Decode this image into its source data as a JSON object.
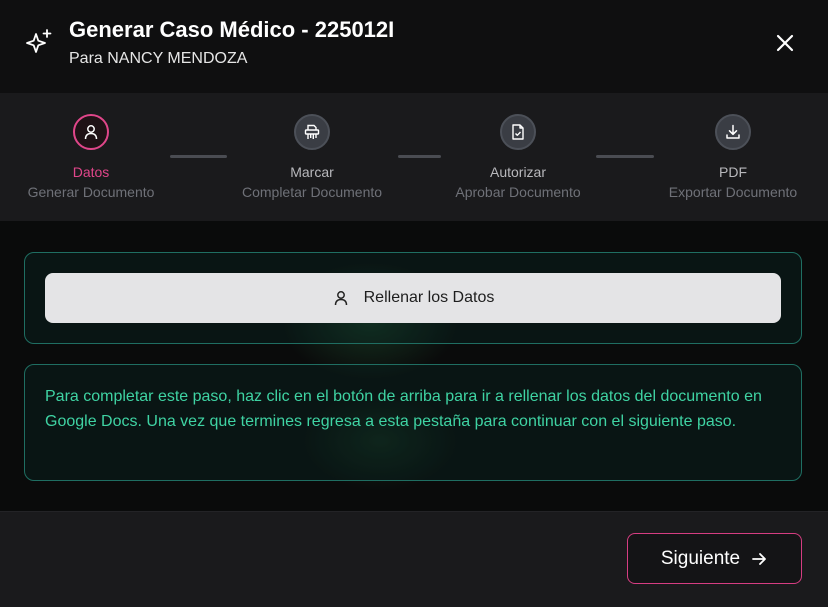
{
  "header": {
    "title": "Generar Caso Médico - 225012I",
    "subtitle": "Para NANCY MENDOZA"
  },
  "steps": [
    {
      "label": "Datos",
      "sub": "Generar Documento",
      "icon": "user-icon",
      "active": true
    },
    {
      "label": "Marcar",
      "sub": "Completar Documento",
      "icon": "shredder-icon",
      "active": false
    },
    {
      "label": "Autorizar",
      "sub": "Aprobar Documento",
      "icon": "file-check-icon",
      "active": false
    },
    {
      "label": "PDF",
      "sub": "Exportar Documento",
      "icon": "download-icon",
      "active": false
    }
  ],
  "fill_button": {
    "label": "Rellenar los Datos",
    "icon": "user-icon"
  },
  "info_text": "Para completar este paso, haz clic en el botón de arriba para ir a rellenar los datos del documento en Google Docs. Una vez que termines regresa a esta pestaña para continuar con el siguiente paso.",
  "footer": {
    "next_label": "Siguiente",
    "next_icon": "arrow-right-icon"
  },
  "colors": {
    "accent": "#e0468a",
    "teal_text": "#3fd3a3",
    "teal_border": "#1f6e62"
  }
}
